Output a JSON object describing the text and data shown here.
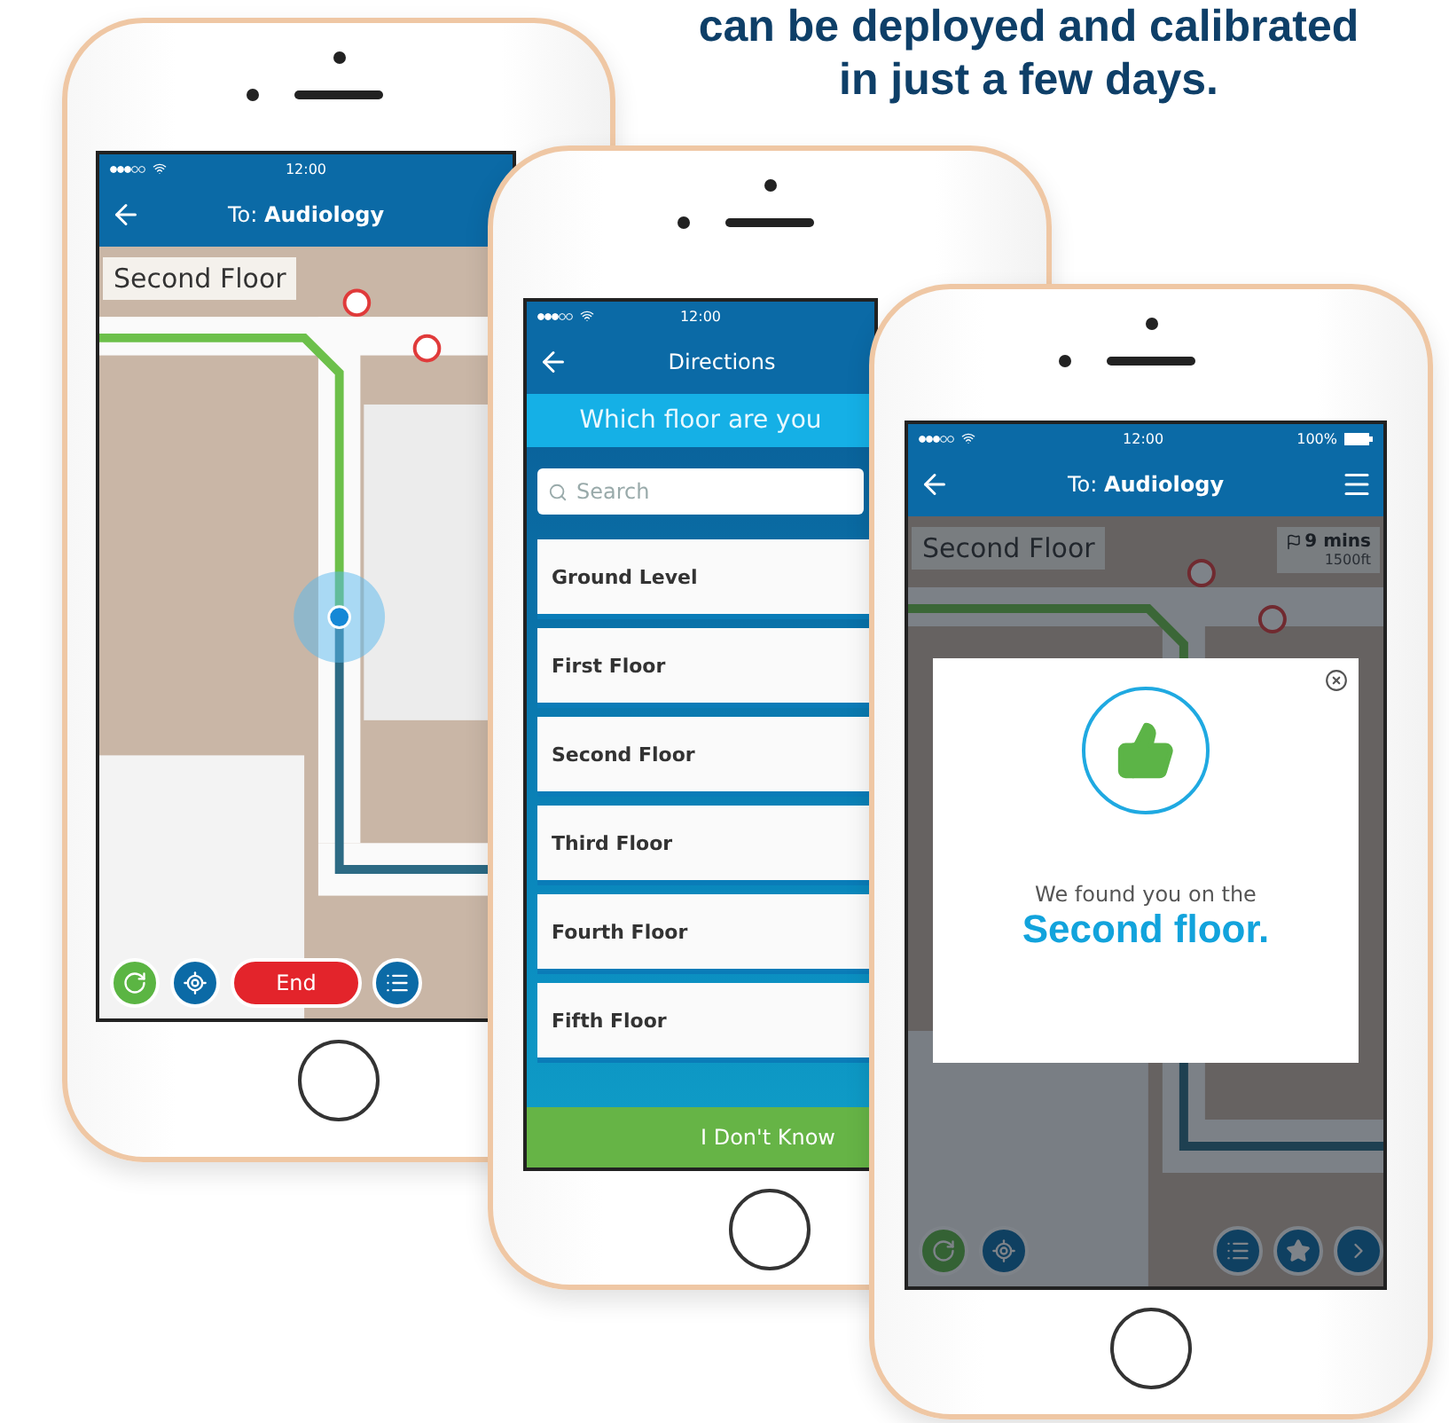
{
  "headline": [
    "can be deployed and calibrated",
    "in just a few days."
  ],
  "phones": [
    {
      "kind": "map",
      "status": {
        "time": "12:00"
      },
      "header": {
        "title": "To: **Audiology**"
      },
      "floor_label": "Second Floor",
      "end_button": "End"
    },
    {
      "kind": "floor_picker",
      "status": {
        "time": "12:00"
      },
      "header": {
        "title": "Directions"
      },
      "question": "Which floor are you",
      "search": {
        "placeholder": "Search"
      },
      "floors": [
        "Ground Level",
        "First Floor",
        "Second Floor",
        "Third Floor",
        "Fourth Floor",
        "Fifth Floor"
      ],
      "footer_button": "I Don't Know"
    },
    {
      "kind": "map_dialog",
      "status": {
        "time": "12:00",
        "battery": "100%"
      },
      "header": {
        "title": "To: **Audiology**"
      },
      "floor_label": "Second Floor",
      "eta": {
        "time": "9 mins",
        "distance": "1500ft"
      },
      "dialog": {
        "message": "We found you on the",
        "floor": "Second floor."
      }
    }
  ]
}
